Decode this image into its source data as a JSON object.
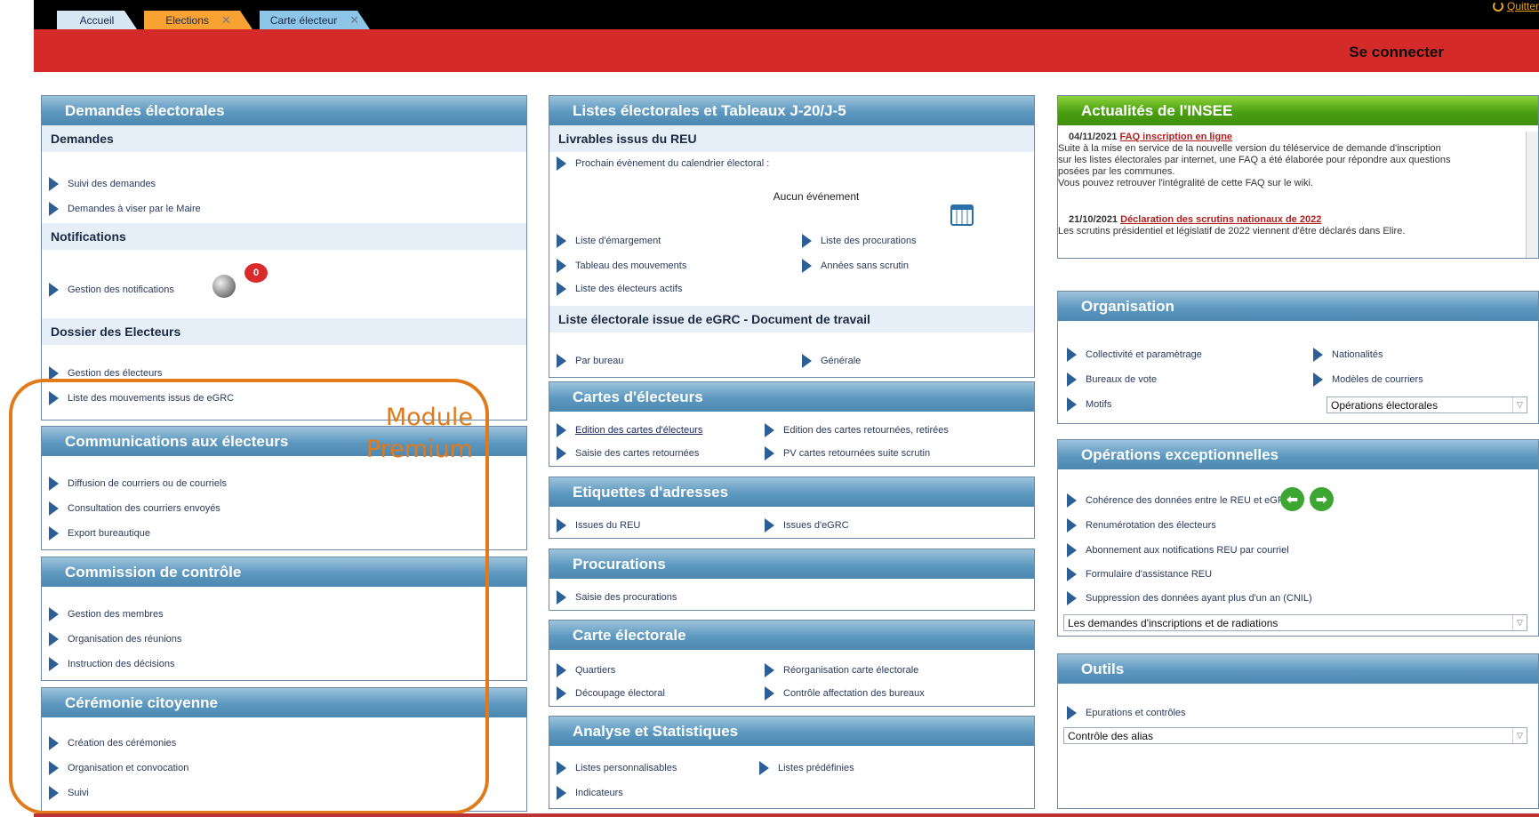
{
  "tabs": [
    {
      "label": "Accueil",
      "color": "#d7e6f3"
    },
    {
      "label": "Elections",
      "color": "#f7a233"
    },
    {
      "label": "Carte électeur",
      "color": "#8ec6e8"
    }
  ],
  "header": {
    "quit_label": "Quitter",
    "connect_label": "Se connecter"
  },
  "demandes": {
    "title": "Demandes électorales",
    "sub1": "Demandes",
    "items1": [
      "Suivi des demandes",
      "Demandes à viser par le Maire"
    ],
    "sub2": "Notifications",
    "items2": [
      "Gestion des notifications"
    ],
    "notif_count": "0",
    "sub3": "Dossier des Electeurs",
    "items3": [
      "Gestion des électeurs",
      "Liste des mouvements issus de eGRC"
    ]
  },
  "communications": {
    "title": "Communications aux électeurs",
    "items": [
      "Diffusion de courriers ou de courriels",
      "Consultation des courriers envoyés",
      "Export bureautique"
    ]
  },
  "commission": {
    "title": "Commission de contrôle",
    "items": [
      "Gestion des membres",
      "Organisation des réunions",
      "Instruction des décisions"
    ]
  },
  "ceremonie": {
    "title": "Cérémonie citoyenne",
    "items": [
      "Création des cérémonies",
      "Organisation et convocation",
      "Suivi"
    ]
  },
  "premium": {
    "line1": "Module",
    "line2": "Premium"
  },
  "listes": {
    "title": "Listes électorales et Tableaux J-20/J-5",
    "sub1": "Livrables issus du REU",
    "next_event": "Prochain évènement du calendrier électoral :",
    "no_event": "Aucun événement",
    "items_left": [
      "Liste d'émargement",
      "Tableau des mouvements",
      "Liste des électeurs actifs"
    ],
    "items_right": [
      "Liste des procurations",
      "Années sans scrutin"
    ],
    "sub2": "Liste électorale issue de eGRC - Document de travail",
    "egrc_items": [
      "Par bureau",
      "Générale"
    ]
  },
  "cartes": {
    "title": "Cartes d'électeurs",
    "items_left": [
      "Edition des cartes d'électeurs",
      "Saisie des cartes retournées"
    ],
    "items_right": [
      "Edition des cartes retournées, retirées",
      "PV cartes retournées suite scrutin"
    ]
  },
  "etiquettes": {
    "title": "Etiquettes d'adresses",
    "items": [
      "Issues du REU",
      "Issues d'eGRC"
    ]
  },
  "procurations": {
    "title": "Procurations",
    "items": [
      "Saisie des procurations"
    ]
  },
  "carte_electorale": {
    "title": "Carte électorale",
    "items_left": [
      "Quartiers",
      "Découpage électoral"
    ],
    "items_right": [
      "Réorganisation carte électorale",
      "Contrôle affectation des bureaux"
    ]
  },
  "analyse": {
    "title": "Analyse et Statistiques",
    "items_left": [
      "Listes personnalisables",
      "Indicateurs"
    ],
    "items_right": [
      "Listes prédéfinies"
    ]
  },
  "insee": {
    "title": "Actualités de l'INSEE",
    "news": [
      {
        "date": "04/11/2021",
        "title": "FAQ inscription en ligne",
        "body": [
          "Suite à la mise en service de la nouvelle version du téléservice de demande d'inscription",
          "sur les listes électorales par internet, une FAQ a été élaborée pour répondre aux questions",
          "posées par les communes.",
          "Vous pouvez retrouver l'intégralité de cette FAQ sur le wiki."
        ]
      },
      {
        "date": "21/10/2021",
        "title": "Déclaration des scrutins nationaux de 2022",
        "body": [
          "Les scrutins présidentiel et législatif de 2022 viennent d'être déclarés dans Elire."
        ]
      }
    ]
  },
  "organisation": {
    "title": "Organisation",
    "items_left": [
      "Collectivité et paramètrage",
      "Bureaux de vote",
      "Motifs"
    ],
    "items_right": [
      "Nationalités",
      "Modèles de courriers"
    ],
    "select_value": "Opérations électorales"
  },
  "operations": {
    "title": "Opérations exceptionnelles",
    "items": [
      "Cohérence des données entre le REU et eGRC",
      "Renumérotation des électeurs",
      "Abonnement aux notifications REU par courriel",
      "Formulaire d'assistance REU",
      "Suppression des données ayant plus d'un an (CNIL)"
    ],
    "select_value": "Les demandes d'inscriptions et de radiations"
  },
  "outils": {
    "title": "Outils",
    "items": [
      "Epurations et contrôles"
    ],
    "select_value": "Contrôle des alias"
  }
}
